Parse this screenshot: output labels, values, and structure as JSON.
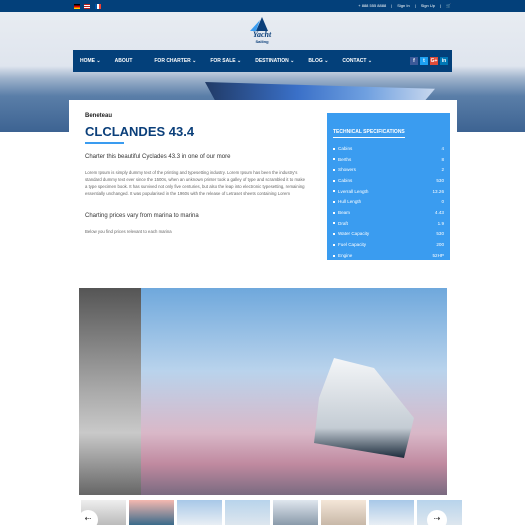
{
  "topbar": {
    "flags": [
      "de-flag",
      "us-flag",
      "fr-flag"
    ],
    "phone": "+ 888 555 8888",
    "sign_in": "Sign In",
    "sign_up": "Sign Up",
    "sep": "|",
    "cart_icon": "cart-icon"
  },
  "logo": {
    "text": "Yacht",
    "sub": "Sailing"
  },
  "nav": {
    "items": [
      {
        "label": "HOME",
        "dropdown": true
      },
      {
        "label": "ABOUT",
        "dropdown": false
      },
      {
        "label": "FOR CHARTER",
        "dropdown": true
      },
      {
        "label": "FOR SALE",
        "dropdown": true
      },
      {
        "label": "DESTINATION",
        "dropdown": true
      },
      {
        "label": "BLOG",
        "dropdown": true
      },
      {
        "label": "CONTACT",
        "dropdown": true
      }
    ],
    "social": [
      {
        "label": "f",
        "color": "#3b5998"
      },
      {
        "label": "t",
        "color": "#1da1f2"
      },
      {
        "label": "G+",
        "color": "#dd4b39"
      },
      {
        "label": "in",
        "color": "#0077b5"
      }
    ]
  },
  "content": {
    "brand": "Beneteau",
    "title": "CLCLANDES 43.4",
    "subtitle": "Charter this beautiful Cyclades 43.3 in one of our more",
    "paragraph": "Lorem Ipsum is simply dummy text of the printing and typesetting industry. Lorem Ipsum has been the industry's standard dummy text ever since the 1500s, when an unknown printer took a galley of type and scrambled it to make a type specimen book. It has survived not only five centuries, but also the leap into electronic typesetting, remaining essentially unchanged. It was popularised in the 1960s with the release of Letraset sheets containing Lorem",
    "subtitle2": "Charting prices vary from marina to marina",
    "below": "Below you find prices relevant to each marina"
  },
  "specs": {
    "title": "TECHNICAL SPECIFICATIONS",
    "rows": [
      {
        "label": "Cabins",
        "value": "4"
      },
      {
        "label": "Berths",
        "value": "8"
      },
      {
        "label": "Showers",
        "value": "2"
      },
      {
        "label": "Cabins",
        "value": "530"
      },
      {
        "label": "Lverrall Length",
        "value": "13.26"
      },
      {
        "label": "Hull Length",
        "value": "0"
      },
      {
        "label": "Beam",
        "value": "4.43"
      },
      {
        "label": "Draft",
        "value": "1.9"
      },
      {
        "label": "Water Capacity",
        "value": "530"
      },
      {
        "label": "Fuel Capacity",
        "value": "200"
      },
      {
        "label": "Engine",
        "value": "52HP"
      }
    ]
  },
  "gallery": {
    "prev_icon": "arrow-left-icon",
    "next_icon": "arrow-right-icon",
    "prev": "⇠",
    "next": "⇢",
    "thumb_count": 8
  },
  "colors": {
    "primary": "#03407a",
    "accent": "#3a9cf0"
  }
}
